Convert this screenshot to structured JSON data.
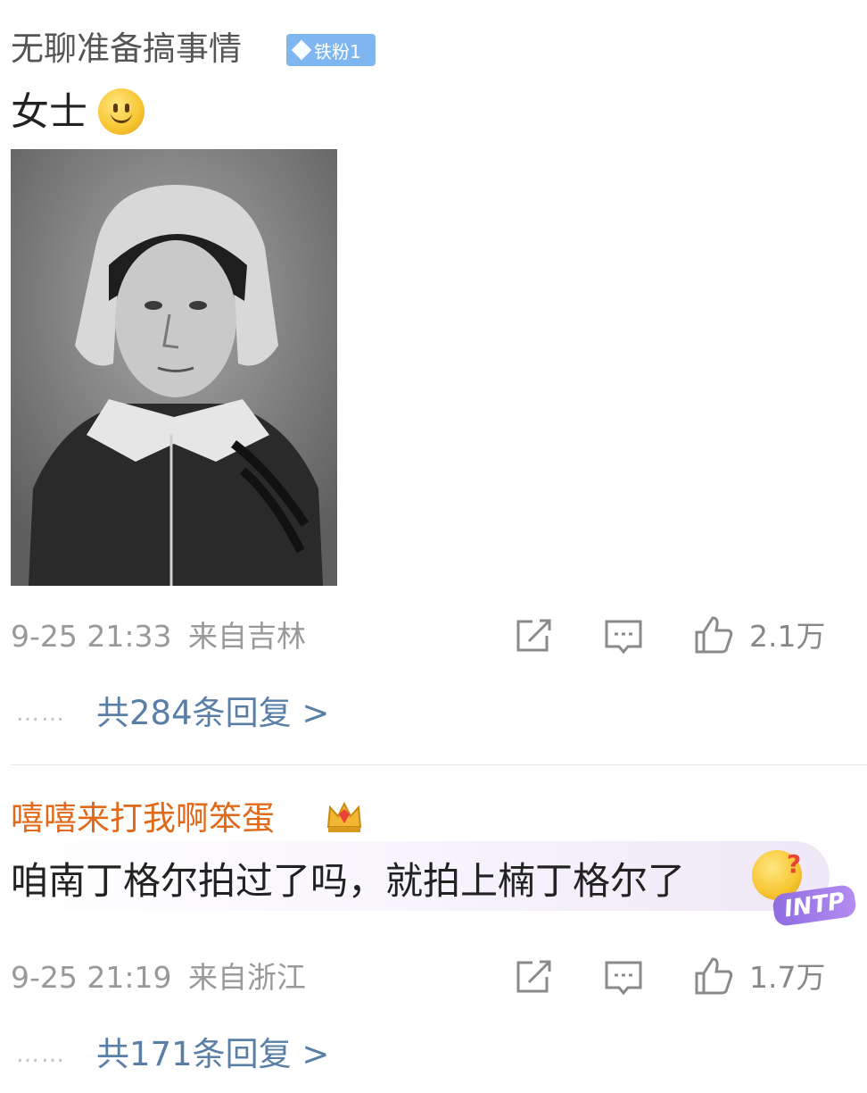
{
  "comments": [
    {
      "username": "无聊准备搞事情",
      "fan_badge": "铁粉1",
      "text": "女士",
      "emoji": "smile-emoji",
      "has_image": true,
      "time": "9-25 21:33",
      "location": "来自吉林",
      "likes": "2.1万",
      "replies_label": "共284条回复 >",
      "more_dots": "……"
    },
    {
      "username": "嘻嘻来打我啊笨蛋",
      "text": "咱南丁格尔拍过了吗，就拍上楠丁格尔了",
      "emoji": "thinking-emoji",
      "bubble_tag": "INTP",
      "time": "9-25 21:19",
      "location": "来自浙江",
      "likes": "1.7万",
      "replies_label": "共171条回复 >",
      "more_dots": "……"
    }
  ],
  "colors": {
    "username_default": "#555555",
    "username_vip": "#e06a1a",
    "reply_link": "#5a7fa7",
    "meta": "#999999",
    "badge": "#7fb6f0"
  },
  "icons": [
    "share-icon",
    "comment-icon",
    "like-icon",
    "crown-icon",
    "diamond-icon"
  ]
}
